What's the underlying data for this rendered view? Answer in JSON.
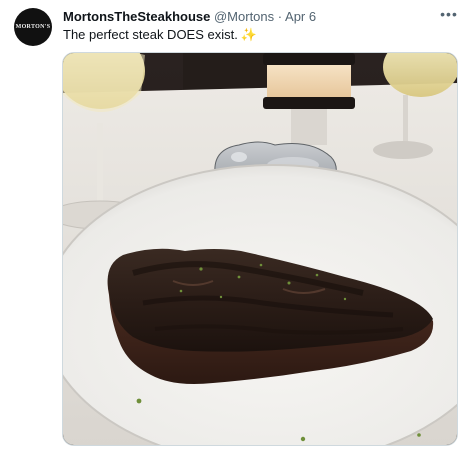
{
  "post": {
    "display_name": "MortonsTheSteakhouse",
    "handle": "@Mortons",
    "separator": "·",
    "date": "Apr 6",
    "text": "The perfect steak DOES exist.",
    "emoji": "✨"
  },
  "avatar": {
    "logo_text": "MORTON'S"
  },
  "media": {
    "description_icon": "steak-photo"
  },
  "colors": {
    "text_primary": "#0f1419",
    "text_secondary": "#536471",
    "border": "#cfd9de"
  }
}
